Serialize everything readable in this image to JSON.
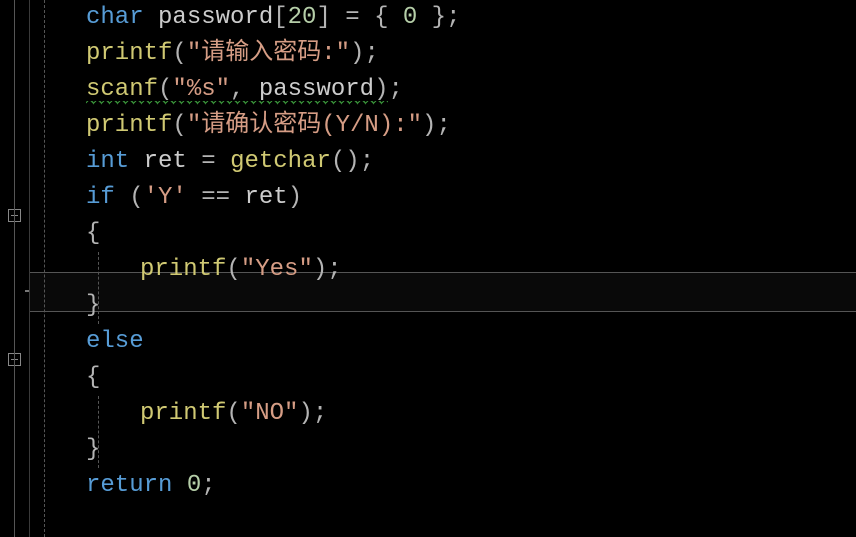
{
  "code": {
    "line1": {
      "kw_char": "char",
      "ident": "password",
      "size": "20",
      "zero": "0"
    },
    "line2": {
      "func": "printf",
      "str": "\"请输入密码:\""
    },
    "line3": {
      "func": "scanf",
      "str": "\"%s\"",
      "arg": "password"
    },
    "line4": {
      "func": "printf",
      "str": "\"请确认密码(Y/N):\""
    },
    "line5": {
      "kw_int": "int",
      "ident": "ret",
      "func": "getchar"
    },
    "line6": {
      "kw_if": "if",
      "charlit": "'Y'",
      "op_eq": "==",
      "ident": "ret"
    },
    "line7": {
      "brace": "{"
    },
    "line8": {
      "func": "printf",
      "str": "\"Yes\""
    },
    "line9": {
      "brace": "}"
    },
    "line10": {
      "kw_else": "else"
    },
    "line11": {
      "brace": "{"
    },
    "line12": {
      "func": "printf",
      "str": "\"NO\""
    },
    "line13": {
      "brace": "}"
    },
    "line14": {
      "kw_return": "return",
      "zero": "0"
    }
  }
}
